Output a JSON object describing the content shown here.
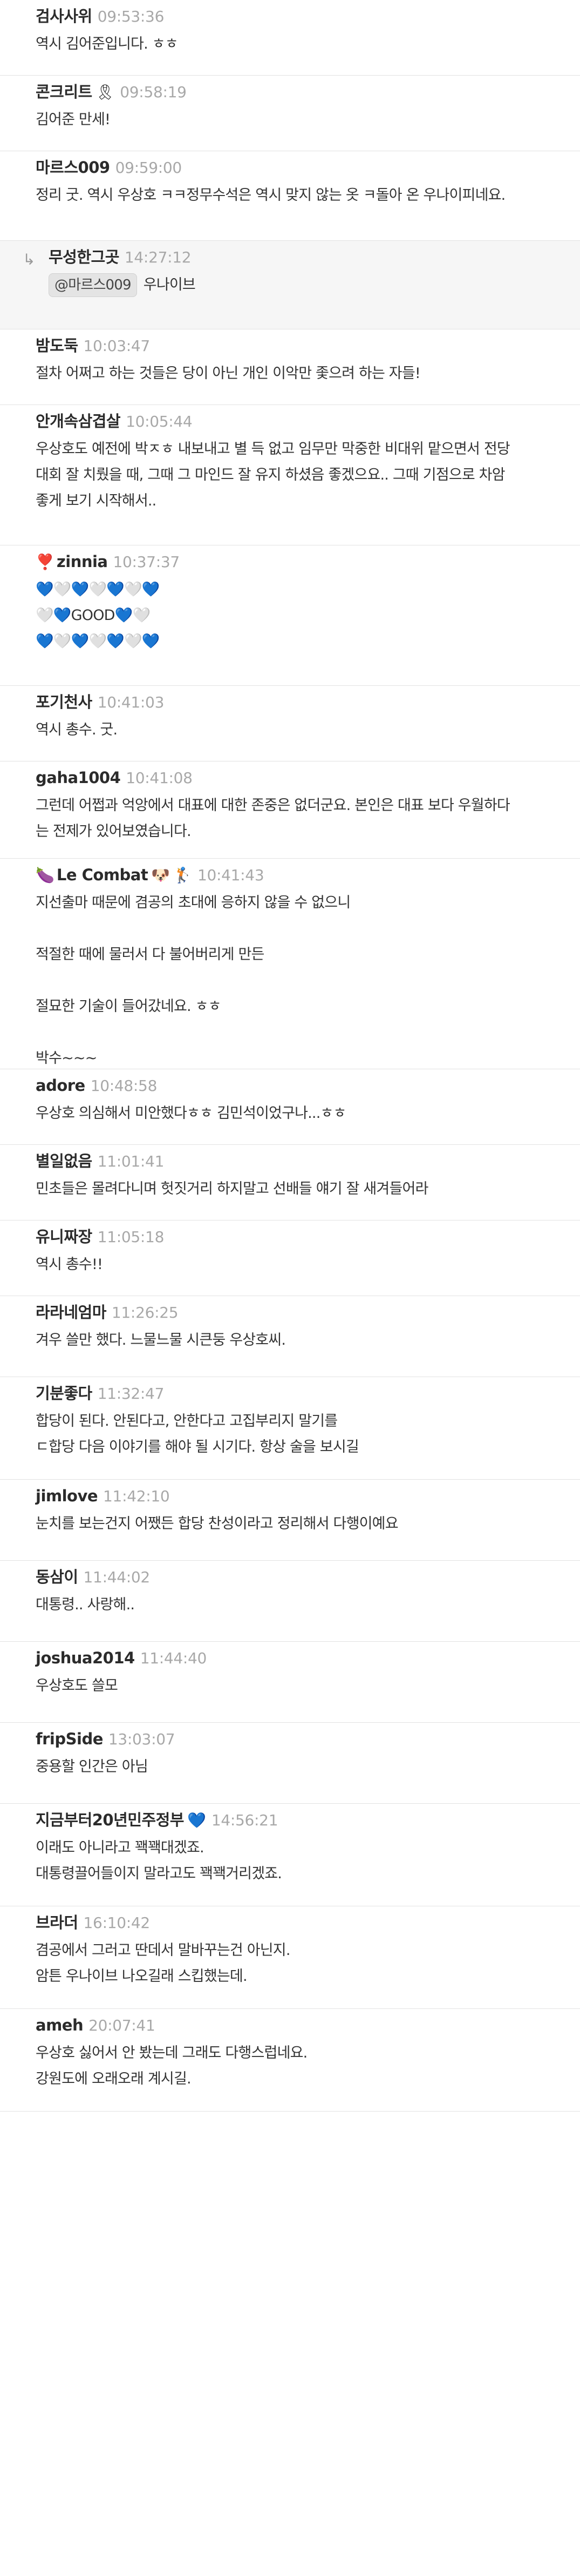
{
  "comments": [
    {
      "author": "검사사위",
      "time": "09:53:36",
      "lines": [
        "역시 김어준입니다. ㅎㅎ"
      ]
    },
    {
      "author": "콘크리트",
      "author_icon": "🎗",
      "time": "09:58:19",
      "lines": [
        "김어준 만세!"
      ]
    },
    {
      "author": "마르스009",
      "time": "09:59:00",
      "lines": [
        "정리 굿. 역시 우상호 ㅋㅋ정무수석은 역시 맞지 않는 옷 ㅋ돌아 온 우나이피네요."
      ]
    },
    {
      "reply": true,
      "author": "무성한그곳",
      "time": "14:27:12",
      "mention": "@마르스009",
      "lines": [
        "우나이브"
      ]
    },
    {
      "author": "밤도둑",
      "time": "10:03:47",
      "lines": [
        "절차 어쩌고 하는 것들은 당이 아닌 개인 이악만 좇으려 하는 자들!"
      ]
    },
    {
      "author": "안개속삼겹살",
      "time": "10:05:44",
      "lines": [
        "우상호도 예전에 박ㅈㅎ 내보내고 별 득 없고 임무만 막중한 비대위 맡으면서 전당",
        "대회 잘 치뤘을 때, 그때 그 마인드 잘 유지 하셨음 좋겠으요.. 그때 기점으로 차암",
        "좋게 보기 시작해서.."
      ]
    },
    {
      "author": "zinnia",
      "author_icon_before": "❣️",
      "time": "10:37:37",
      "hearts": true,
      "lines": [
        "💙🤍💙🤍💙🤍💙",
        "🤍💙GOOD💙🤍",
        "💙🤍💙🤍💙🤍💙"
      ]
    },
    {
      "author": "포기천사",
      "time": "10:41:03",
      "lines": [
        "역시 총수. 굿."
      ]
    },
    {
      "author": "gaha1004",
      "time": "10:41:08",
      "lines": [
        "그런데 어쩝과 억앙에서 대표에 대한 존중은 없더군요. 본인은 대표 보다 우월하다",
        "는 전제가 있어보였습니다."
      ]
    },
    {
      "author": "Le  Combat",
      "author_icon_before": "🍆",
      "author_icon_mid": "🐶",
      "author_icon": "🏌",
      "time": "10:41:43",
      "lines": [
        "지선출마 때문에 겸공의 초대에 응하지 않을 수 없으니",
        "",
        "적절한 때에 물러서 다 불어버리게 만든",
        "",
        "절묘한 기술이 들어갔네요. ㅎㅎ",
        "",
        "박수~~~"
      ]
    },
    {
      "author": "adore",
      "time": "10:48:58",
      "lines": [
        "우상호 의심해서 미안했다ㅎㅎ 김민석이었구나...ㅎㅎ"
      ]
    },
    {
      "author": "별일없음",
      "time": "11:01:41",
      "lines": [
        "민초들은 몰려다니며 헛짓거리 하지말고 선배들 얘기 잘 새겨들어라"
      ]
    },
    {
      "author": "유니짜장",
      "time": "11:05:18",
      "lines": [
        "역시 총수!!"
      ]
    },
    {
      "author": "라라네엄마",
      "time": "11:26:25",
      "lines": [
        "겨우 쓸만 했다. 느물느물 시큰둥 우상호씨."
      ]
    },
    {
      "author": "기분좋다",
      "time": "11:32:47",
      "lines": [
        "합당이 된다. 안된다고, 안한다고 고집부리지 말기를",
        "ㄷ합당 다음 이야기를 해야 될 시기다. 항상 술을 보시길"
      ]
    },
    {
      "author": "jimlove",
      "time": "11:42:10",
      "lines": [
        "눈치를 보는건지 어쨌든 합당 찬성이라고 정리해서 다행이예요"
      ]
    },
    {
      "author": "동삼이",
      "time": "11:44:02",
      "lines": [
        "대통령.. 사랑해.."
      ]
    },
    {
      "author": "joshua2014",
      "time": "11:44:40",
      "lines": [
        "우상호도 쓸모"
      ]
    },
    {
      "author": "fripSide",
      "time": "13:03:07",
      "lines": [
        "중용할 인간은 아님"
      ]
    },
    {
      "author": "지금부터20년민주정부",
      "author_icon": "💙",
      "time": "14:56:21",
      "lines": [
        "이래도 아니라고 꽥꽥대겠죠.",
        "대통령끌어들이지 말라고도 꽥꽥거리겠죠."
      ]
    },
    {
      "author": "브라더",
      "time": "16:10:42",
      "lines": [
        "겸공에서 그러고 딴데서 말바꾸는건 아닌지.",
        "암튼 우나이브 나오길래 스킵했는데."
      ]
    },
    {
      "author": "ameh",
      "time": "20:07:41",
      "lines": [
        "우상호 싫어서 안 봤는데 그래도 다행스럽네요.",
        "강원도에 오래오래 계시길."
      ]
    }
  ]
}
